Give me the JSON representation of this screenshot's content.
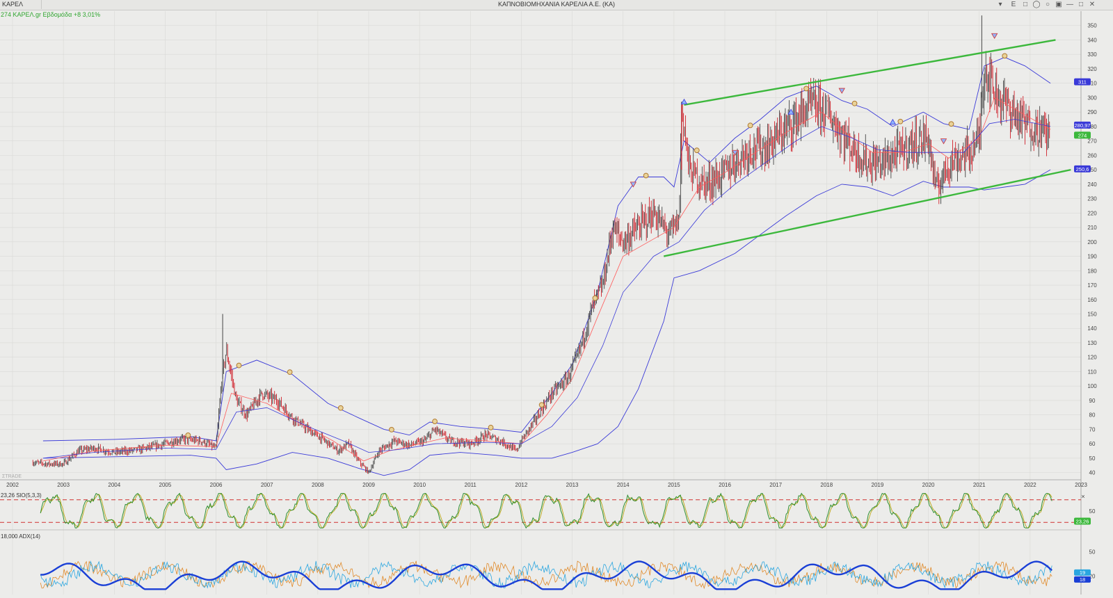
{
  "window": {
    "symbol": "ΚΑΡΕΛ",
    "title": "ΚΑΠΝΟΒΙΟΜΗΧΑΝΙΑ ΚΑΡΕΛΙΑ Α.Ε. (ΚΑ)",
    "e_label": "E"
  },
  "price_header": "274 ΚΑΡΕΛ.gr Εβδομάδα +8 3,01%",
  "watermark": "ΣTRADE",
  "colors": {
    "up_candle": "#444444",
    "down_candle": "#d0202a",
    "bollinger": "#3a3ad8",
    "ma": "#ff5a5a",
    "channel": "#3cb83c",
    "stoch_k": "#2f8f2f",
    "stoch_d": "#b8a000",
    "adx": "#1a3fd6",
    "plus_di": "#2aa6e0",
    "minus_di": "#e08a2a",
    "signal_marker": "#b07a30"
  },
  "chart_data": [
    {
      "type": "candlestick",
      "title": "",
      "x_tick_labels": [
        "2002",
        "2003",
        "2004",
        "2005",
        "2006",
        "2007",
        "2008",
        "2009",
        "2010",
        "2011",
        "2012",
        "2013",
        "2014",
        "2015",
        "2016",
        "2017",
        "2018",
        "2019",
        "2020",
        "2021",
        "2022",
        "2023"
      ],
      "xlim": [
        2002.0,
        2023.0
      ],
      "y_tick_labels": [
        "40",
        "50",
        "60",
        "70",
        "80",
        "90",
        "100",
        "110",
        "120",
        "130",
        "140",
        "150",
        "160",
        "170",
        "180",
        "190",
        "200",
        "210",
        "220",
        "230",
        "240",
        "250",
        "260",
        "270",
        "280",
        "290",
        "300",
        "310",
        "320",
        "330",
        "340",
        "350"
      ],
      "ylim": [
        35,
        360
      ],
      "last_value_labels": [
        {
          "text": "311",
          "value": 311,
          "color": "#3a3ad8"
        },
        {
          "text": "280,97",
          "value": 280.97,
          "color": "#3a3ad8"
        },
        {
          "text": "274",
          "value": 274,
          "color": "#3cb83c"
        },
        {
          "text": "250,6",
          "value": 250.6,
          "color": "#3a3ad8"
        }
      ],
      "approx_close_path": [
        [
          2002.4,
          47
        ],
        [
          2002.7,
          46
        ],
        [
          2003.0,
          46
        ],
        [
          2003.3,
          55
        ],
        [
          2003.6,
          57
        ],
        [
          2004.0,
          54
        ],
        [
          2004.5,
          56
        ],
        [
          2005.0,
          60
        ],
        [
          2005.3,
          63
        ],
        [
          2005.7,
          62
        ],
        [
          2006.0,
          57
        ],
        [
          2006.1,
          100
        ],
        [
          2006.2,
          125
        ],
        [
          2006.4,
          90
        ],
        [
          2006.6,
          80
        ],
        [
          2006.9,
          95
        ],
        [
          2007.2,
          90
        ],
        [
          2007.5,
          78
        ],
        [
          2007.8,
          70
        ],
        [
          2008.1,
          63
        ],
        [
          2008.4,
          55
        ],
        [
          2008.6,
          60
        ],
        [
          2008.8,
          48
        ],
        [
          2009.0,
          40
        ],
        [
          2009.2,
          55
        ],
        [
          2009.5,
          62
        ],
        [
          2009.8,
          59
        ],
        [
          2010.1,
          62
        ],
        [
          2010.3,
          70
        ],
        [
          2010.6,
          62
        ],
        [
          2011.0,
          60
        ],
        [
          2011.3,
          66
        ],
        [
          2011.6,
          62
        ],
        [
          2011.9,
          55
        ],
        [
          2012.0,
          62
        ],
        [
          2012.3,
          78
        ],
        [
          2012.6,
          95
        ],
        [
          2012.9,
          105
        ],
        [
          2013.1,
          120
        ],
        [
          2013.4,
          155
        ],
        [
          2013.6,
          170
        ],
        [
          2013.8,
          210
        ],
        [
          2014.0,
          200
        ],
        [
          2014.3,
          210
        ],
        [
          2014.6,
          220
        ],
        [
          2014.9,
          205
        ],
        [
          2015.1,
          215
        ],
        [
          2015.15,
          295
        ],
        [
          2015.3,
          250
        ],
        [
          2015.6,
          240
        ],
        [
          2015.9,
          245
        ],
        [
          2016.2,
          255
        ],
        [
          2016.5,
          265
        ],
        [
          2016.8,
          265
        ],
        [
          2017.1,
          275
        ],
        [
          2017.4,
          285
        ],
        [
          2017.7,
          295
        ],
        [
          2018.0,
          290
        ],
        [
          2018.2,
          280
        ],
        [
          2018.5,
          265
        ],
        [
          2018.8,
          255
        ],
        [
          2019.1,
          255
        ],
        [
          2019.4,
          262
        ],
        [
          2019.7,
          268
        ],
        [
          2020.0,
          272
        ],
        [
          2020.15,
          235
        ],
        [
          2020.4,
          255
        ],
        [
          2020.8,
          262
        ],
        [
          2021.0,
          272
        ],
        [
          2021.1,
          322
        ],
        [
          2021.3,
          305
        ],
        [
          2021.6,
          292
        ],
        [
          2021.9,
          282
        ],
        [
          2022.2,
          278
        ],
        [
          2022.4,
          274
        ]
      ],
      "bollinger_upper": [
        [
          2002.6,
          62
        ],
        [
          2004.0,
          63
        ],
        [
          2005.5,
          65
        ],
        [
          2006.0,
          62
        ],
        [
          2006.2,
          110
        ],
        [
          2006.8,
          118
        ],
        [
          2007.5,
          108
        ],
        [
          2008.2,
          88
        ],
        [
          2008.8,
          78
        ],
        [
          2009.3,
          70
        ],
        [
          2009.8,
          66
        ],
        [
          2010.2,
          75
        ],
        [
          2010.8,
          72
        ],
        [
          2011.5,
          70
        ],
        [
          2012.0,
          68
        ],
        [
          2012.6,
          95
        ],
        [
          2013.0,
          115
        ],
        [
          2013.5,
          165
        ],
        [
          2013.9,
          225
        ],
        [
          2014.3,
          245
        ],
        [
          2014.8,
          245
        ],
        [
          2015.0,
          238
        ],
        [
          2015.2,
          270
        ],
        [
          2015.7,
          255
        ],
        [
          2016.2,
          272
        ],
        [
          2016.7,
          285
        ],
        [
          2017.2,
          300
        ],
        [
          2017.8,
          308
        ],
        [
          2018.3,
          298
        ],
        [
          2018.8,
          292
        ],
        [
          2019.3,
          280
        ],
        [
          2019.9,
          290
        ],
        [
          2020.3,
          282
        ],
        [
          2020.8,
          278
        ],
        [
          2021.1,
          322
        ],
        [
          2021.5,
          328
        ],
        [
          2021.9,
          322
        ],
        [
          2022.4,
          310
        ]
      ],
      "bollinger_lower": [
        [
          2002.6,
          50
        ],
        [
          2004.0,
          51
        ],
        [
          2005.5,
          52
        ],
        [
          2006.0,
          50
        ],
        [
          2006.2,
          42
        ],
        [
          2006.8,
          46
        ],
        [
          2007.5,
          54
        ],
        [
          2008.2,
          50
        ],
        [
          2008.8,
          43
        ],
        [
          2009.3,
          38
        ],
        [
          2009.8,
          42
        ],
        [
          2010.2,
          52
        ],
        [
          2010.8,
          54
        ],
        [
          2011.5,
          52
        ],
        [
          2012.0,
          50
        ],
        [
          2012.6,
          50
        ],
        [
          2013.0,
          54
        ],
        [
          2013.5,
          60
        ],
        [
          2013.9,
          72
        ],
        [
          2014.3,
          98
        ],
        [
          2014.8,
          145
        ],
        [
          2015.0,
          175
        ],
        [
          2015.5,
          180
        ],
        [
          2016.2,
          192
        ],
        [
          2016.7,
          205
        ],
        [
          2017.2,
          218
        ],
        [
          2017.8,
          232
        ],
        [
          2018.3,
          240
        ],
        [
          2018.8,
          238
        ],
        [
          2019.3,
          232
        ],
        [
          2019.9,
          242
        ],
        [
          2020.3,
          238
        ],
        [
          2020.8,
          238
        ],
        [
          2021.1,
          236
        ],
        [
          2021.5,
          238
        ],
        [
          2021.9,
          240
        ],
        [
          2022.4,
          250
        ]
      ],
      "ma_fast": [
        [
          2002.6,
          48
        ],
        [
          2003.6,
          55
        ],
        [
          2005.0,
          59
        ],
        [
          2006.0,
          58
        ],
        [
          2006.3,
          95
        ],
        [
          2007.0,
          88
        ],
        [
          2007.6,
          75
        ],
        [
          2008.3,
          62
        ],
        [
          2008.9,
          48
        ],
        [
          2009.4,
          55
        ],
        [
          2010.0,
          60
        ],
        [
          2010.5,
          64
        ],
        [
          2011.3,
          62
        ],
        [
          2012.0,
          60
        ],
        [
          2012.5,
          80
        ],
        [
          2013.0,
          105
        ],
        [
          2013.5,
          148
        ],
        [
          2014.0,
          190
        ],
        [
          2014.5,
          200
        ],
        [
          2015.0,
          210
        ],
        [
          2015.5,
          238
        ],
        [
          2016.0,
          248
        ],
        [
          2016.6,
          262
        ],
        [
          2017.3,
          278
        ],
        [
          2017.9,
          290
        ],
        [
          2018.4,
          275
        ],
        [
          2018.9,
          262
        ],
        [
          2019.5,
          262
        ],
        [
          2020.0,
          268
        ],
        [
          2020.4,
          258
        ],
        [
          2021.0,
          272
        ],
        [
          2021.3,
          300
        ],
        [
          2021.8,
          290
        ],
        [
          2022.4,
          278
        ]
      ],
      "ma_slow": [
        [
          2002.6,
          50
        ],
        [
          2003.6,
          54
        ],
        [
          2005.0,
          57
        ],
        [
          2006.0,
          56
        ],
        [
          2006.4,
          82
        ],
        [
          2007.0,
          85
        ],
        [
          2007.8,
          72
        ],
        [
          2008.5,
          62
        ],
        [
          2009.0,
          54
        ],
        [
          2009.6,
          56
        ],
        [
          2010.3,
          60
        ],
        [
          2011.3,
          61
        ],
        [
          2012.0,
          60
        ],
        [
          2012.6,
          72
        ],
        [
          2013.1,
          92
        ],
        [
          2013.6,
          128
        ],
        [
          2014.0,
          165
        ],
        [
          2014.6,
          190
        ],
        [
          2015.1,
          200
        ],
        [
          2015.6,
          222
        ],
        [
          2016.2,
          240
        ],
        [
          2016.8,
          255
        ],
        [
          2017.4,
          270
        ],
        [
          2017.9,
          280
        ],
        [
          2018.5,
          272
        ],
        [
          2019.0,
          264
        ],
        [
          2019.6,
          262
        ],
        [
          2020.2,
          262
        ],
        [
          2020.7,
          262
        ],
        [
          2021.2,
          282
        ],
        [
          2021.7,
          285
        ],
        [
          2022.4,
          280
        ]
      ],
      "channel_lines": [
        {
          "from": [
            2015.2,
            295
          ],
          "to": [
            2022.5,
            340
          ]
        },
        {
          "from": [
            2014.8,
            190
          ],
          "to": [
            2022.8,
            250
          ]
        }
      ],
      "vertical_segment": {
        "from": [
          2015.15,
          250
        ],
        "to": [
          2015.15,
          295
        ]
      }
    },
    {
      "type": "line",
      "title": "",
      "legend_label": "23,26 SlO(5,3,3)",
      "ylim": [
        0,
        100
      ],
      "y_tick_labels": [
        "50"
      ],
      "reference_lines": [
        80,
        20
      ],
      "last_value_label": "23,26"
    },
    {
      "type": "line",
      "title": "",
      "legend_label": "18,000 ADX(14)",
      "ylim": [
        0,
        70
      ],
      "y_tick_labels": [
        "50",
        "20"
      ],
      "last_value_labels": [
        "19",
        "18"
      ]
    }
  ]
}
